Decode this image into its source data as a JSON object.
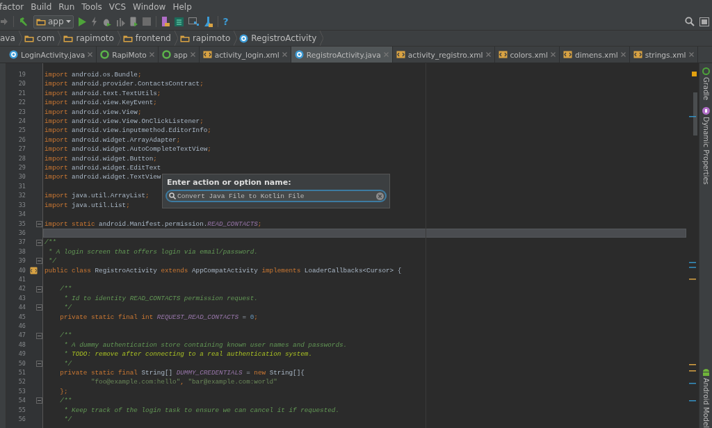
{
  "menu": [
    "factor",
    "Build",
    "Run",
    "Tools",
    "VCS",
    "Window",
    "Help"
  ],
  "toolbar": {
    "run_config": "app",
    "help": "?"
  },
  "breadcrumbs": [
    {
      "label": "ava",
      "kind": "text"
    },
    {
      "label": "com",
      "kind": "package"
    },
    {
      "label": "rapimoto",
      "kind": "package"
    },
    {
      "label": "frontend",
      "kind": "package"
    },
    {
      "label": "rapimoto",
      "kind": "package"
    },
    {
      "label": "RegistroActivity",
      "kind": "class"
    }
  ],
  "tabs": [
    {
      "label": "LoginActivity.java",
      "kind": "class",
      "selected": false
    },
    {
      "label": "RapiMoto",
      "kind": "module",
      "selected": false
    },
    {
      "label": "app",
      "kind": "module",
      "selected": false
    },
    {
      "label": "activity_login.xml",
      "kind": "xml",
      "selected": false
    },
    {
      "label": "RegistroActivity.java",
      "kind": "class",
      "selected": true
    },
    {
      "label": "activity_registro.xml",
      "kind": "xml",
      "selected": false
    },
    {
      "label": "colors.xml",
      "kind": "xml",
      "selected": false
    },
    {
      "label": "dimens.xml",
      "kind": "xml",
      "selected": false
    },
    {
      "label": "strings.xml",
      "kind": "xml",
      "selected": false
    }
  ],
  "editor": {
    "lines": [
      {
        "n": "19",
        "current": false,
        "code": [
          {
            "kind": "kw",
            "text": "import "
          },
          {
            "kind": "p",
            "text": "android.os.Bundle"
          },
          {
            "kind": "kw",
            "text": ";"
          }
        ]
      },
      {
        "n": "20",
        "current": false,
        "code": [
          {
            "kind": "kw",
            "text": "import "
          },
          {
            "kind": "p",
            "text": "android.provider.ContactsContract"
          },
          {
            "kind": "kw",
            "text": ";"
          }
        ]
      },
      {
        "n": "21",
        "current": false,
        "code": [
          {
            "kind": "kw",
            "text": "import "
          },
          {
            "kind": "p",
            "text": "android.text.TextUtils"
          },
          {
            "kind": "kw",
            "text": ";"
          }
        ]
      },
      {
        "n": "22",
        "current": false,
        "code": [
          {
            "kind": "kw",
            "text": "import "
          },
          {
            "kind": "p",
            "text": "android.view.KeyEvent"
          },
          {
            "kind": "kw",
            "text": ";"
          }
        ]
      },
      {
        "n": "23",
        "current": false,
        "code": [
          {
            "kind": "kw",
            "text": "import "
          },
          {
            "kind": "p",
            "text": "android.view.View"
          },
          {
            "kind": "kw",
            "text": ";"
          }
        ]
      },
      {
        "n": "24",
        "current": false,
        "code": [
          {
            "kind": "kw",
            "text": "import "
          },
          {
            "kind": "p",
            "text": "android.view.View.OnClickListener"
          },
          {
            "kind": "kw",
            "text": ";"
          }
        ]
      },
      {
        "n": "25",
        "current": false,
        "code": [
          {
            "kind": "kw",
            "text": "import "
          },
          {
            "kind": "p",
            "text": "android.view.inputmethod.EditorInfo"
          },
          {
            "kind": "kw",
            "text": ";"
          }
        ]
      },
      {
        "n": "26",
        "current": false,
        "code": [
          {
            "kind": "kw",
            "text": "import "
          },
          {
            "kind": "p",
            "text": "android.widget.ArrayAdapter"
          },
          {
            "kind": "kw",
            "text": ";"
          }
        ]
      },
      {
        "n": "27",
        "current": false,
        "code": [
          {
            "kind": "kw",
            "text": "import "
          },
          {
            "kind": "p",
            "text": "android.widget.AutoCompleteTextView"
          },
          {
            "kind": "kw",
            "text": ";"
          }
        ]
      },
      {
        "n": "28",
        "current": false,
        "code": [
          {
            "kind": "kw",
            "text": "import "
          },
          {
            "kind": "p",
            "text": "android.widget.Button"
          },
          {
            "kind": "kw",
            "text": ";"
          }
        ]
      },
      {
        "n": "29",
        "current": false,
        "code": [
          {
            "kind": "kw",
            "text": "import "
          },
          {
            "kind": "p",
            "text": "android.widget.EditText"
          }
        ]
      },
      {
        "n": "30",
        "current": false,
        "code": [
          {
            "kind": "kw",
            "text": "import "
          },
          {
            "kind": "p",
            "text": "android.widget.TextView"
          }
        ]
      },
      {
        "n": "31",
        "current": false
      },
      {
        "n": "32",
        "current": false,
        "code": [
          {
            "kind": "kw",
            "text": "import "
          },
          {
            "kind": "p",
            "text": "java.util.ArrayList"
          },
          {
            "kind": "kw",
            "text": ";"
          }
        ]
      },
      {
        "n": "33",
        "current": false,
        "code": [
          {
            "kind": "kw",
            "text": "import "
          },
          {
            "kind": "p",
            "text": "java.util.List"
          },
          {
            "kind": "kw",
            "text": ";"
          }
        ]
      },
      {
        "n": "34",
        "current": false
      },
      {
        "n": "35",
        "current": false,
        "kind": "fold",
        "code": [
          {
            "kind": "kw",
            "text": "import static "
          },
          {
            "kind": "p",
            "text": "android.Manifest.permission."
          },
          {
            "kind": "const",
            "text": "READ_CONTACTS"
          },
          {
            "kind": "kw",
            "text": ";"
          }
        ]
      },
      {
        "n": "36",
        "current": true
      },
      {
        "n": "37",
        "current": false,
        "kind": "fold",
        "code": [
          {
            "kind": "doc",
            "text": "/**"
          }
        ]
      },
      {
        "n": "38",
        "current": false,
        "code": [
          {
            "kind": "doc",
            "text": " * A login screen that offers login via email/password."
          }
        ]
      },
      {
        "n": "39",
        "current": false,
        "kind": "fold",
        "code": [
          {
            "kind": "doc",
            "text": " */"
          }
        ]
      },
      {
        "n": "40",
        "current": false,
        "kind": "implements",
        "code": [
          {
            "kind": "kw",
            "text": "public class "
          },
          {
            "kind": "p",
            "text": "RegistroActivity "
          },
          {
            "kind": "kw",
            "text": "extends "
          },
          {
            "kind": "p",
            "text": "AppCompatActivity "
          },
          {
            "kind": "kw",
            "text": "implements "
          },
          {
            "kind": "p",
            "text": "LoaderCallbacks<Cursor> {"
          }
        ]
      },
      {
        "n": "41",
        "current": false
      },
      {
        "n": "42",
        "current": false,
        "kind": "fold",
        "code": [
          {
            "kind": "doc",
            "text": "    /**"
          }
        ]
      },
      {
        "n": "43",
        "current": false,
        "code": [
          {
            "kind": "doc",
            "text": "     * Id to identity READ_CONTACTS permission request."
          }
        ]
      },
      {
        "n": "44",
        "current": false,
        "kind": "fold",
        "code": [
          {
            "kind": "doc",
            "text": "     */"
          }
        ]
      },
      {
        "n": "45",
        "current": false,
        "code": [
          {
            "kind": "kw",
            "text": "    private static final int "
          },
          {
            "kind": "const",
            "text": "REQUEST_READ_CONTACTS"
          },
          {
            "kind": "p",
            "text": " = "
          },
          {
            "kind": "num",
            "text": "0"
          },
          {
            "kind": "kw",
            "text": ";"
          }
        ]
      },
      {
        "n": "46",
        "current": false
      },
      {
        "n": "47",
        "current": false,
        "kind": "fold",
        "code": [
          {
            "kind": "doc",
            "text": "    /**"
          }
        ]
      },
      {
        "n": "48",
        "current": false,
        "code": [
          {
            "kind": "doc",
            "text": "     * A dummy authentication store containing known user names and passwords."
          }
        ]
      },
      {
        "n": "49",
        "current": false,
        "code": [
          {
            "kind": "doc",
            "text": "     * "
          },
          {
            "kind": "todo",
            "text": "TODO: remove after connecting to a real authentication system."
          }
        ]
      },
      {
        "n": "50",
        "current": false,
        "kind": "fold",
        "code": [
          {
            "kind": "doc",
            "text": "     */"
          }
        ]
      },
      {
        "n": "51",
        "current": false,
        "code": [
          {
            "kind": "kw",
            "text": "    private static final "
          },
          {
            "kind": "p",
            "text": "String[] "
          },
          {
            "kind": "const",
            "text": "DUMMY_CREDENTIALS"
          },
          {
            "kind": "p",
            "text": " = "
          },
          {
            "kind": "kw",
            "text": "new "
          },
          {
            "kind": "p",
            "text": "String[]{"
          }
        ]
      },
      {
        "n": "52",
        "current": false,
        "code": [
          {
            "kind": "str",
            "text": "            \"foo@example.com:hello\""
          },
          {
            "kind": "kw",
            "text": ", "
          },
          {
            "kind": "str",
            "text": "\"bar@example.com:world\""
          }
        ]
      },
      {
        "n": "53",
        "current": false,
        "code": [
          {
            "kind": "kw",
            "text": "    };"
          }
        ]
      },
      {
        "n": "54",
        "current": false,
        "kind": "fold",
        "code": [
          {
            "kind": "doc",
            "text": "    /**"
          }
        ]
      },
      {
        "n": "55",
        "current": false,
        "code": [
          {
            "kind": "doc",
            "text": "     * Keep track of the login task to ensure we can cancel it if requested."
          }
        ]
      },
      {
        "n": "56",
        "current": false,
        "code": [
          {
            "kind": "doc",
            "text": "     */"
          }
        ]
      }
    ]
  },
  "popup": {
    "title": "Enter action or option name:",
    "value": "Convert Java File to Kotlin File"
  },
  "side_tools": [
    {
      "label": "Gradle",
      "kind": "gradle"
    },
    {
      "label": "Dynamic Properties",
      "kind": "properties"
    },
    {
      "label": "Android Model",
      "kind": "android"
    }
  ]
}
